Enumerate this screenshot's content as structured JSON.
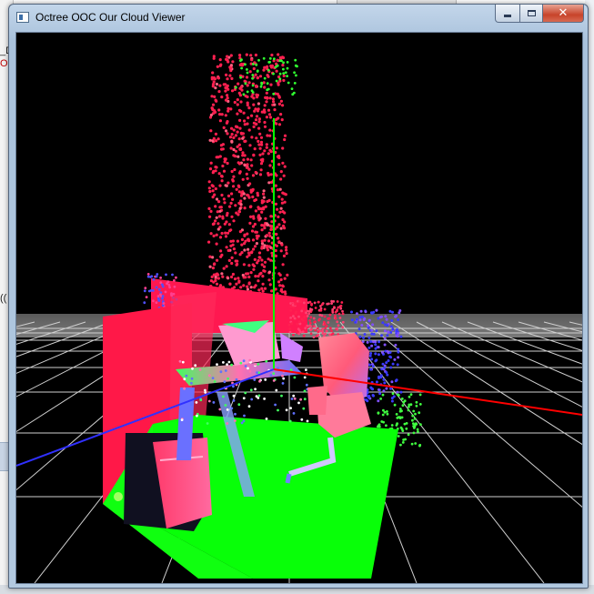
{
  "window": {
    "title": "Octree OOC Our Cloud Viewer",
    "icon": "app-window-icon"
  },
  "controls": {
    "minimize_icon": "minimize-icon",
    "maximize_icon": "maximize-icon",
    "close_icon": "close-icon"
  },
  "background_fragments": [
    "_D",
    "Ou",
    "(("
  ],
  "colors": {
    "viewport_background": "#000000",
    "grid": "#d0d0d0",
    "axis_x": "#ff0000",
    "axis_y": "#00ff00",
    "axis_z": "#3030ff"
  }
}
